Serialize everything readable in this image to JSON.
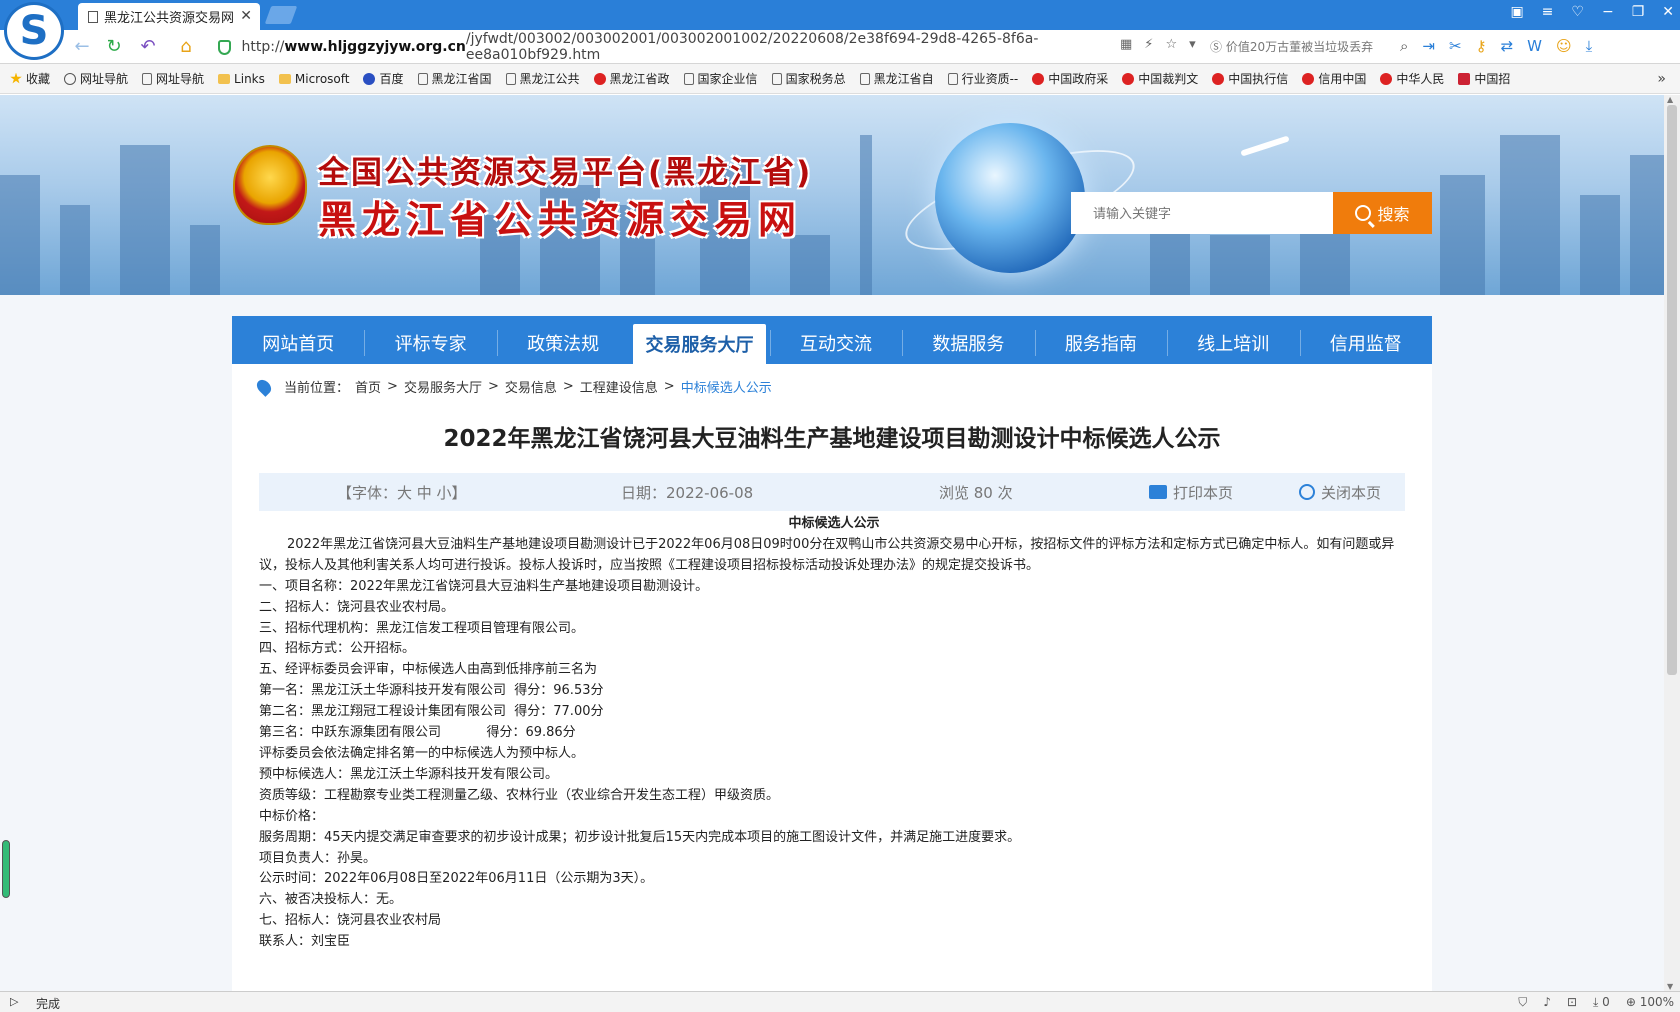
{
  "browser": {
    "tab_title": "黑龙江公共资源交易网",
    "url_prefix": "http://",
    "url_domain": "www.hljggzyjyw.org.cn",
    "url_path": "/jyfwdt/003002/003002001/003002001002/20220608/2e38f694-29d8-4265-8f6a-ee8a010bf929.htm",
    "search_hint": "价值20万古董被当垃圾丢弃",
    "bookmarks": [
      "收藏",
      "网址导航",
      "网址导航",
      "Links",
      "Microsoft",
      "百度",
      "黑龙江省国",
      "黑龙江公共",
      "黑龙江省政",
      "国家企业信",
      "国家税务总",
      "黑龙江省自",
      "行业资质--",
      "中国政府采",
      "中国裁判文",
      "中国执行信",
      "信用中国",
      "中华人民",
      "中国招"
    ],
    "status_text": "完成",
    "zoom": "100%",
    "download_count": "0"
  },
  "site": {
    "title_line1": "全国公共资源交易平台(黑龙江省)",
    "title_line2": "黑龙江省公共资源交易网",
    "search_placeholder": "请输入关键字",
    "search_button": "搜索",
    "nav": [
      "网站首页",
      "评标专家",
      "政策法规",
      "交易服务大厅",
      "互动交流",
      "数据服务",
      "服务指南",
      "线上培训",
      "信用监督"
    ],
    "nav_active_index": 3,
    "colors": {
      "nav_blue": "#2c81d8",
      "search_orange": "#f07c0c",
      "title_red": "#c81010"
    }
  },
  "breadcrumb": {
    "label": "当前位置：",
    "items": [
      "首页",
      "交易服务大厅",
      "交易信息",
      "工程建设信息"
    ],
    "current": "中标候选人公示",
    "separator": ">"
  },
  "article": {
    "title": "2022年黑龙江省饶河县大豆油料生产基地建设项目勘测设计中标候选人公示",
    "font_label": "【字体：大 中 小】",
    "date": "日期：2022-06-08",
    "views": "浏览 80 次",
    "print": "打印本页",
    "close": "关闭本页",
    "heading": "中标候选人公示",
    "intro": "2022年黑龙江省饶河县大豆油料生产基地建设项目勘测设计已于2022年06月08日09时00分在双鸭山市公共资源交易中心开标，按招标文件的评标方法和定标方式已确定中标人。如有问题或异议，投标人及其他利害关系人均可进行投诉。投标人投诉时，应当按照《工程建设项目招标投标活动投诉处理办法》的规定提交投诉书。",
    "lines": [
      "一、项目名称：2022年黑龙江省饶河县大豆油料生产基地建设项目勘测设计。",
      "二、招标人：饶河县农业农村局。",
      "三、招标代理机构：黑龙江信发工程项目管理有限公司。",
      "四、招标方式：公开招标。",
      "五、经评标委员会评审，中标候选人由高到低排序前三名为",
      "第一名：黑龙江沃土华源科技开发有限公司  得分：96.53分",
      "第二名：黑龙江翔冠工程设计集团有限公司  得分：77.00分",
      "第三名：中跃东源集团有限公司           得分：69.86分",
      "评标委员会依法确定排名第一的中标候选人为预中标人。",
      "预中标候选人：黑龙江沃土华源科技开发有限公司。",
      "资质等级：工程勘察专业类工程测量乙级、农林行业（农业综合开发生态工程）甲级资质。",
      "中标价格：",
      "服务周期：45天内提交满足审查要求的初步设计成果；初步设计批复后15天内完成本项目的施工图设计文件，并满足施工进度要求。",
      "项目负责人：孙昊。",
      "公示时间：2022年06月08日至2022年06月11日（公示期为3天）。",
      "六、被否决投标人：无。",
      "七、招标人：饶河县农业农村局",
      "联系人：刘宝臣"
    ]
  }
}
